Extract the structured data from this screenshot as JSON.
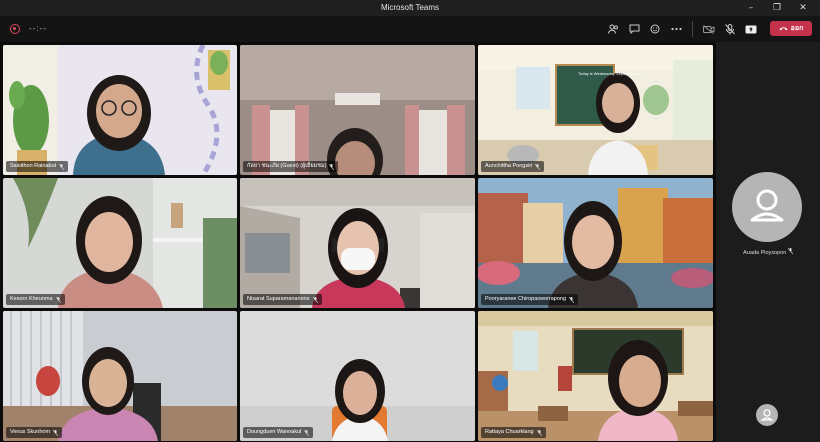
{
  "window": {
    "title": "Microsoft Teams"
  },
  "toolbar": {
    "timer": "--:--",
    "leave_label": "ออก",
    "icons": [
      "people-icon",
      "chat-icon",
      "reactions-icon",
      "more-icon",
      "camera-off-icon",
      "mic-off-icon",
      "share-icon"
    ]
  },
  "participants": [
    {
      "name": "Saisithon Rainabut",
      "muted": true,
      "active": false
    },
    {
      "name": "กัลยา ชนะภัย (Guest) (ผู้เยี่ยมชม)",
      "muted": true,
      "active": false
    },
    {
      "name": "Aunchittha Pongsiri",
      "muted": true,
      "active": false
    },
    {
      "name": "Kesorn Kheunma",
      "muted": true,
      "active": false
    },
    {
      "name": "Nisarat Suparamananone",
      "muted": true,
      "active": true
    },
    {
      "name": "Pooryaranee Chiropasworrapong",
      "muted": true,
      "active": false
    },
    {
      "name": "Venus Skunhom",
      "muted": true,
      "active": false
    },
    {
      "name": "Doungduen Wannakul",
      "muted": true,
      "active": false
    },
    {
      "name": "Rattaya Chuarklang",
      "muted": true,
      "active": false
    }
  ],
  "side_panel": {
    "participant_name": "Auada Ploysopon",
    "muted": true
  },
  "scene_text": {
    "board_title": "Today is Wednesday September 15"
  },
  "colors": {
    "leave": "#c4314b",
    "active_border": "#6e75c8",
    "record": "#e04b5c"
  }
}
